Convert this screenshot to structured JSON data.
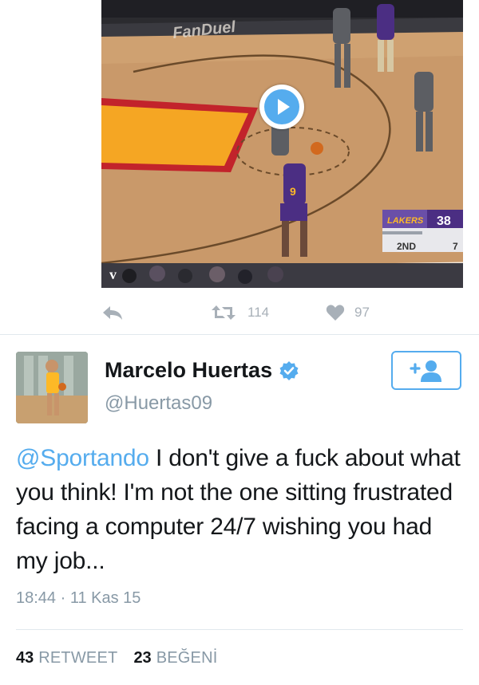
{
  "previous_tweet": {
    "video": {
      "scoreboard_team": "LAKERS",
      "scoreboard_score": "38",
      "scoreboard_period": "2ND",
      "scoreboard_extra": "7",
      "jersey_number": "9",
      "court_brand": "FanDuel"
    },
    "actions": {
      "reply_icon": "reply-icon",
      "retweet_icon": "retweet-icon",
      "retweet_count": "114",
      "like_icon": "heart-icon",
      "like_count": "97"
    }
  },
  "tweet": {
    "author": {
      "name": "Marcelo Huertas",
      "handle": "@Huertas09",
      "verified": true
    },
    "follow_icon": "add-user-icon",
    "mention": "@Sportando",
    "body": " I don't give a fuck about what you think! I'm not the one sitting frustrated facing a computer 24/7 wishing you had my job...",
    "timestamp": "18:44 · 11 Kas 15",
    "stats": {
      "retweet_count": "43",
      "retweet_label": "RETWEET",
      "like_count": "23",
      "like_label": "BEĞENİ"
    }
  },
  "colors": {
    "accent": "#55acee",
    "text": "#14171a",
    "muted": "#8899a6",
    "icon_muted": "#a8b0b8",
    "divider": "#e1e8ed"
  }
}
